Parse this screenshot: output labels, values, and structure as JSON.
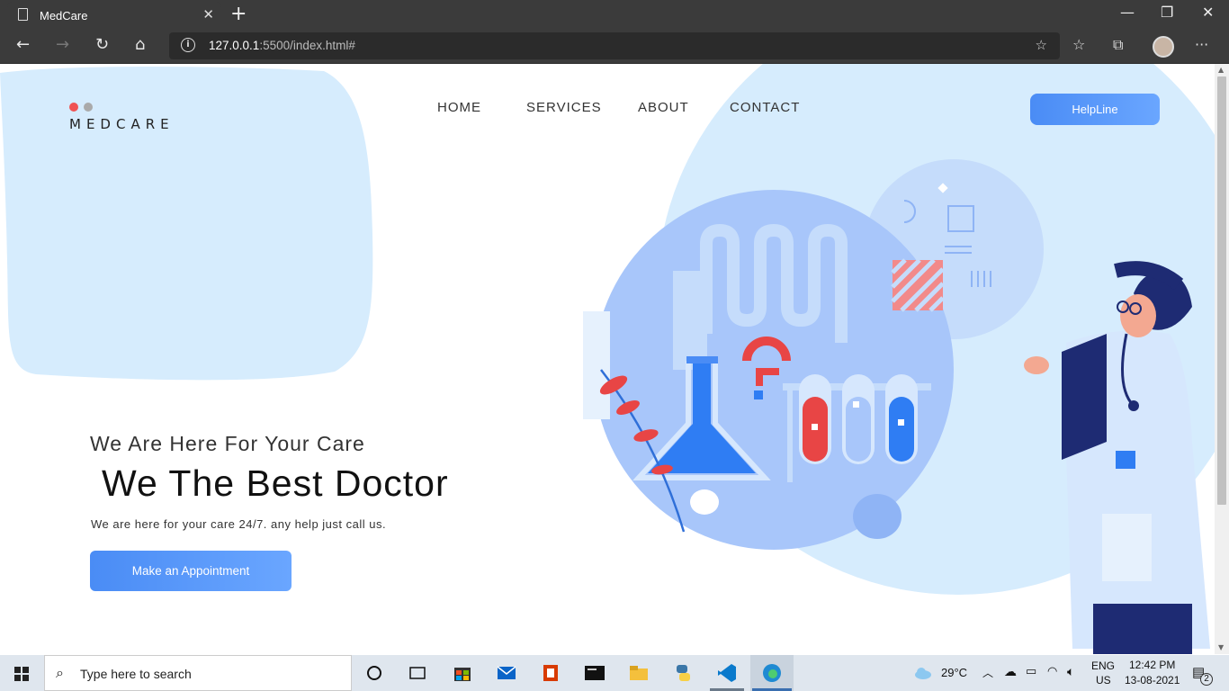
{
  "browser": {
    "tab_title": "MedCare",
    "url_host": "127.0.0.1",
    "url_rest": ":5500/index.html#"
  },
  "site": {
    "brand": "MEDCARE",
    "nav": [
      "HOME",
      "SERVICES",
      "ABOUT",
      "CONTACT"
    ],
    "helpline_label": "HelpLine",
    "tagline": "We Are Here For Your Care",
    "headline": "We The Best Doctor",
    "subline": "We are here for your care 24/7. any help just call us.",
    "cta_label": "Make an Appointment",
    "colors": {
      "accent": "#4a8cf5",
      "blob": "#d6ecfd",
      "circle": "#a8c6fa",
      "red": "#e84545"
    }
  },
  "taskbar": {
    "search_placeholder": "Type here to search",
    "weather": "29°C",
    "lang_1": "ENG",
    "lang_2": "US",
    "time": "12:42 PM",
    "date": "13-08-2021",
    "notifications": "2"
  }
}
